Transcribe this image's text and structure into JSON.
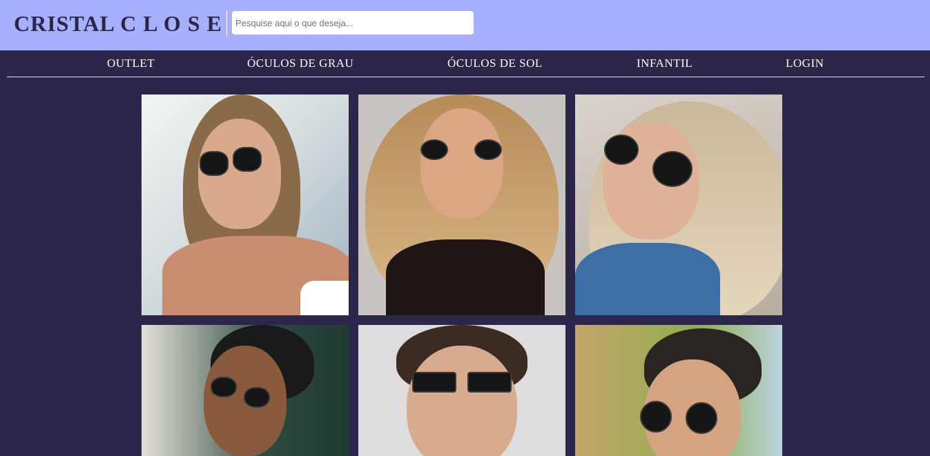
{
  "header": {
    "logo": "CRISTAL C L O S E",
    "search_placeholder": "Pesquise aqui o que deseja..."
  },
  "nav": {
    "items": [
      {
        "label": "OUTLET"
      },
      {
        "label": "ÓCULOS DE GRAU"
      },
      {
        "label": "ÓCULOS DE SOL"
      },
      {
        "label": "INFANTIL"
      },
      {
        "label": "LOGIN"
      }
    ]
  },
  "colors": {
    "header_bg": "#a7b0fd",
    "page_bg": "#2b264a",
    "logo": "#2b264a",
    "nav_text": "#ffffff"
  },
  "gallery": {
    "photos": [
      {
        "subject": "woman-hexagonal-sunglasses"
      },
      {
        "subject": "woman-blonde-round-sunglasses"
      },
      {
        "subject": "woman-aviator-sunglasses"
      },
      {
        "subject": "man-braids-sunglasses"
      },
      {
        "subject": "man-square-sunglasses"
      },
      {
        "subject": "man-round-sunglasses"
      }
    ]
  }
}
